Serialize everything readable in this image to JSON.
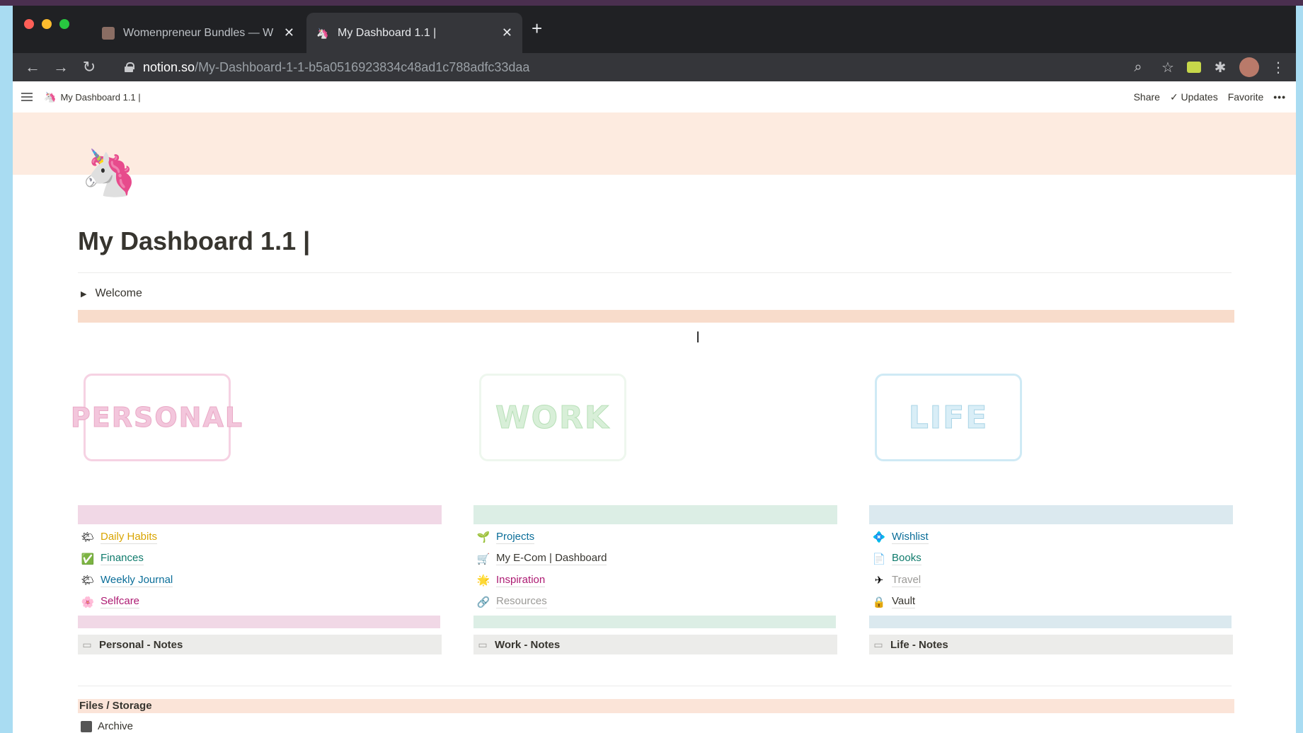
{
  "browser": {
    "tabs": [
      {
        "title": "Womenpreneur Bundles — W",
        "active": false
      },
      {
        "title": "My Dashboard 1.1 |",
        "active": true
      }
    ],
    "new_tab": "+",
    "close": "✕",
    "url_host": "notion.so",
    "url_path": "/My-Dashboard-1-1-b5a0516923834c48ad1c788adfc33daa"
  },
  "notion_topbar": {
    "breadcrumb": "My Dashboard 1.1 |",
    "share": "Share",
    "updates": "✓ Updates",
    "favorite": "Favorite",
    "more": "•••"
  },
  "page": {
    "icon": "🦄",
    "title": "My Dashboard 1.1 |",
    "toggle": "Welcome",
    "headers": {
      "personal": "PERSONAL",
      "work": "WORK",
      "life": "LIFE"
    },
    "columns": [
      {
        "links": [
          {
            "icon": "🌤",
            "label": "Daily Habits",
            "color": "#d9a400"
          },
          {
            "icon": "✅",
            "label": "Finances",
            "color": "#0f7b6c"
          },
          {
            "icon": "🌤",
            "label": "Weekly Journal",
            "color": "#0b6e99"
          },
          {
            "icon": "🌸",
            "label": "Selfcare",
            "color": "#ad1a72"
          }
        ],
        "notes": "Personal - Notes"
      },
      {
        "links": [
          {
            "icon": "🌱",
            "label": "Projects",
            "color": "#0b6e99"
          },
          {
            "icon": "🛒",
            "label": "My E-Com | Dashboard",
            "color": "#37352f"
          },
          {
            "icon": "🌟",
            "label": "Inspiration",
            "color": "#ad1a72"
          },
          {
            "icon": "🔗",
            "label": "Resources",
            "color": "#9b9a97"
          }
        ],
        "notes": "Work - Notes"
      },
      {
        "links": [
          {
            "icon": "💠",
            "label": "Wishlist",
            "color": "#0b6e99"
          },
          {
            "icon": "📄",
            "label": "Books",
            "color": "#0f7b6c"
          },
          {
            "icon": "✈",
            "label": "Travel",
            "color": "#9b9a97"
          },
          {
            "icon": "🔒",
            "label": "Vault",
            "color": "#37352f"
          }
        ],
        "notes": "Life - Notes"
      }
    ],
    "files_heading": "Files / Storage",
    "archive": "Archive"
  }
}
